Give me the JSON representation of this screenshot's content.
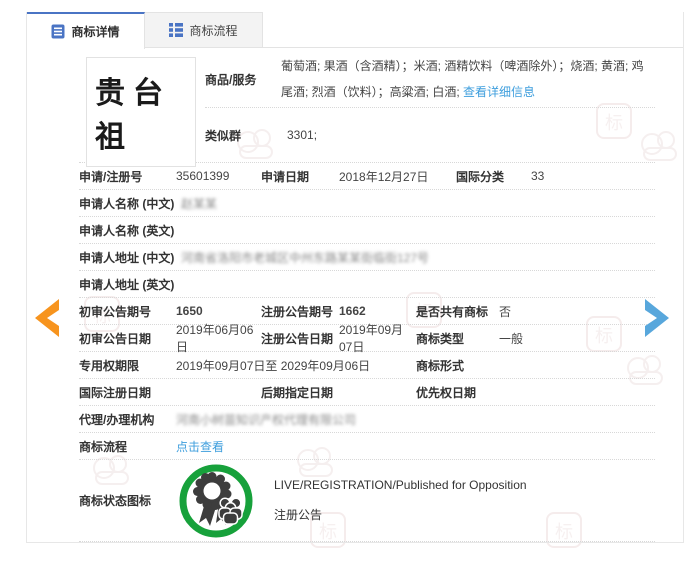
{
  "colors": {
    "tab_accent": "#4a74c4",
    "link_blue": "#3e9edd",
    "arrow_left_orange": "#f7941e",
    "arrow_right_blue": "#58a7dc",
    "status_green": "#17a13b",
    "medal_dark": "#3d3d3d"
  },
  "tabs": {
    "details": "商标详情",
    "process": "商标流程"
  },
  "trademark": {
    "name": "贵台祖"
  },
  "top": {
    "goods_label": "商品/服务",
    "goods_value": "葡萄酒; 果酒（含酒精）；米酒; 酒精饮料（啤酒除外）；烧酒; 黄酒; 鸡尾酒; 烈酒（饮料）；高粱酒; 白酒; ",
    "goods_link": "查看详细信息",
    "similar_group_label": "类似群",
    "similar_group_value": "3301;"
  },
  "fields": {
    "reg_no_label": "申请/注册号",
    "reg_no": "35601399",
    "app_date_label": "申请日期",
    "app_date": "2018年12月27日",
    "intl_class_label": "国际分类",
    "intl_class": "33",
    "applicant_name_cn_label": "申请人名称 (中文)",
    "applicant_name_cn": "赵某某",
    "applicant_name_en_label": "申请人名称 (英文)",
    "applicant_name_en": "",
    "applicant_addr_cn_label": "申请人地址 (中文)",
    "applicant_addr_cn": "河南省洛阳市老城区中州东路某某街临街127号",
    "applicant_addr_en_label": "申请人地址 (英文)",
    "applicant_addr_en": "",
    "first_pub_no_label": "初审公告期号",
    "first_pub_no": "1650",
    "reg_pub_no_label": "注册公告期号",
    "reg_pub_no": "1662",
    "shared_tm_label": "是否共有商标",
    "shared_tm": "否",
    "first_pub_date_label": "初审公告日期",
    "first_pub_date": "2019年06月06日",
    "reg_pub_date_label": "注册公告日期",
    "reg_pub_date": "2019年09月07日",
    "tm_type_label": "商标类型",
    "tm_type": "一般",
    "term_label": "专用权期限",
    "term": "2019年09月07日至 2029年09月06日",
    "tm_form_label": "商标形式",
    "tm_form": "",
    "intl_reg_date_label": "国际注册日期",
    "intl_reg_date": "",
    "later_desig_date_label": "后期指定日期",
    "later_desig_date": "",
    "priority_date_label": "优先权日期",
    "priority_date": "",
    "agency_label": "代理/办理机构",
    "agency": "河南小树苗知识产权代理有限公司",
    "process_label": "商标流程",
    "process_link": "点击查看"
  },
  "status": {
    "label": "商标状态图标",
    "line1": "LIVE/REGISTRATION/Published for Opposition",
    "line2": "注册公告"
  }
}
